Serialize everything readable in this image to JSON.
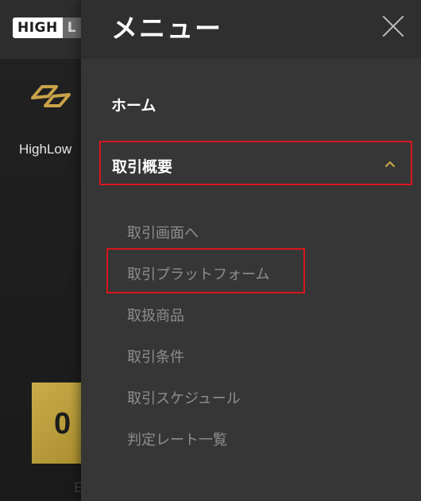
{
  "background": {
    "logo": {
      "high": "HIGH",
      "low": "L"
    },
    "brand_name": "HighLow",
    "tile_text": "0",
    "footer_text": "日"
  },
  "drawer": {
    "title": "メニュー",
    "close_icon": "close-icon",
    "home_label": "ホーム",
    "section": {
      "label": "取引概要",
      "expanded": true,
      "chevron_icon": "chevron-up-icon",
      "items": [
        {
          "label": "取引画面へ"
        },
        {
          "label": "取引プラットフォーム",
          "highlighted": true
        },
        {
          "label": "取扱商品"
        },
        {
          "label": "取引条件"
        },
        {
          "label": "取引スケジュール"
        },
        {
          "label": "判定レート一覧"
        }
      ]
    }
  },
  "colors": {
    "accent_gold": "#c9a24a",
    "highlight_red": "#d8161e",
    "drawer_bg": "#363636"
  }
}
